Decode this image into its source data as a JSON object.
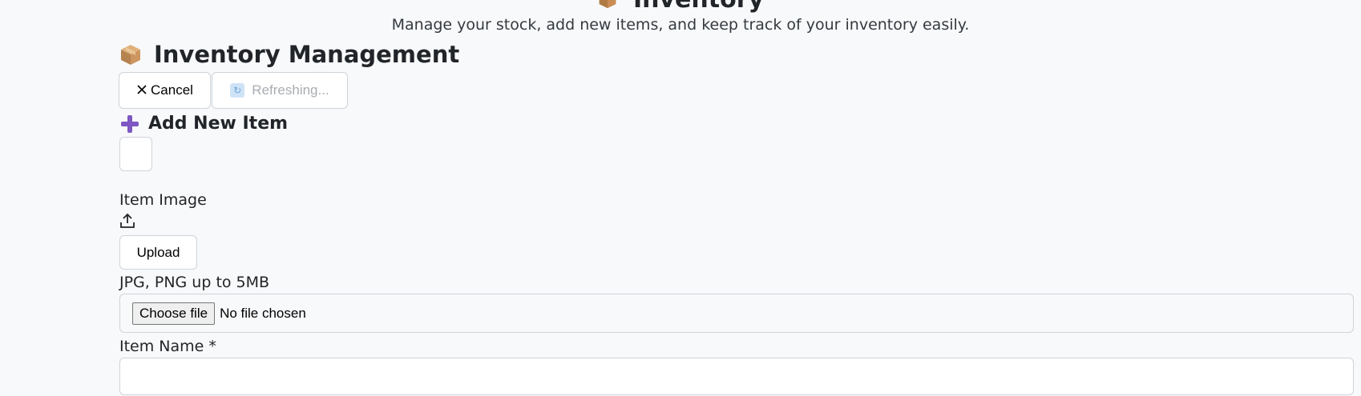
{
  "hero": {
    "title": "Inventory",
    "subtitle": "Manage your stock, add new items, and keep track of your inventory easily."
  },
  "page": {
    "title": "Inventory Management"
  },
  "actions": {
    "cancel_label": "Cancel",
    "refresh_label": "Refreshing..."
  },
  "form": {
    "section_title": "Add New Item",
    "image_label": "Item Image",
    "upload_label": "Upload",
    "image_hint": "JPG, PNG up to 5MB",
    "file_button_label": "Choose file",
    "file_status": "No file chosen",
    "name_label": "Item Name *",
    "name_value": ""
  },
  "colors": {
    "background": "#f8f9fa",
    "border": "#ced4da",
    "plus_icon": "#7e57c2",
    "refresh_icon": "#cfe3f7"
  }
}
